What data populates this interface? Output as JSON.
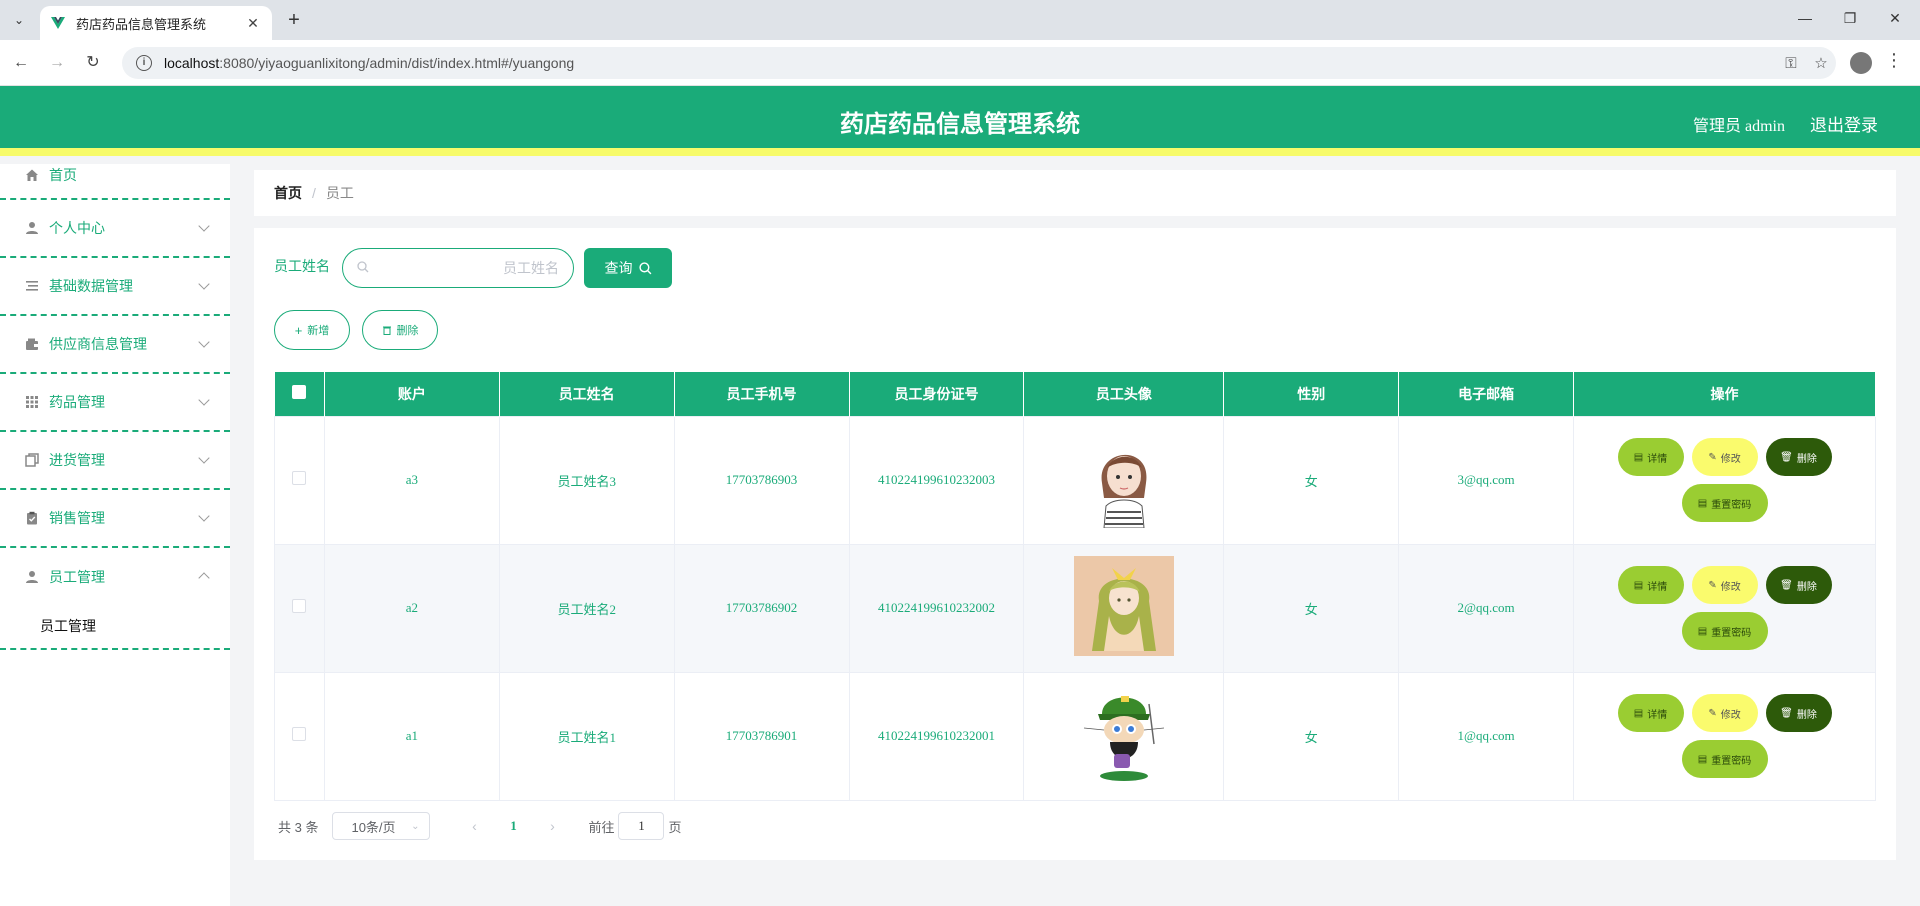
{
  "browser": {
    "tab_title": "药店药品信息管理系统",
    "url_host": "localhost",
    "url_rest": ":8080/yiyaoguanlixitong/admin/dist/index.html#/yuangong"
  },
  "header": {
    "title": "药店药品信息管理系统",
    "admin_label": "管理员 admin",
    "logout_label": "退出登录"
  },
  "sidebar": {
    "items": [
      {
        "label": "首页",
        "icon": "home-icon"
      },
      {
        "label": "个人中心",
        "icon": "user-icon"
      },
      {
        "label": "基础数据管理",
        "icon": "list-icon"
      },
      {
        "label": "供应商信息管理",
        "icon": "wallet-icon"
      },
      {
        "label": "药品管理",
        "icon": "grid-icon"
      },
      {
        "label": "进货管理",
        "icon": "copy-icon"
      },
      {
        "label": "销售管理",
        "icon": "clipboard-icon"
      },
      {
        "label": "员工管理",
        "icon": "user-icon"
      }
    ],
    "submenu_label": "员工管理"
  },
  "breadcrumb": {
    "home": "首页",
    "separator": "/",
    "current": "员工"
  },
  "search": {
    "label": "员工姓名",
    "placeholder": "员工姓名",
    "query_label": "查询"
  },
  "actions": {
    "add_label": "新增",
    "delete_label": "删除"
  },
  "table": {
    "headers": [
      "账户",
      "员工姓名",
      "员工手机号",
      "员工身份证号",
      "员工头像",
      "性别",
      "电子邮箱",
      "操作"
    ],
    "rows": [
      {
        "account": "a3",
        "name": "员工姓名3",
        "phone": "17703786903",
        "idcard": "410224199610232003",
        "avatar": "girl-sketch-avatar",
        "gender": "女",
        "email": "3@qq.com"
      },
      {
        "account": "a2",
        "name": "员工姓名2",
        "phone": "17703786902",
        "idcard": "410224199610232002",
        "avatar": "green-hair-girl-avatar",
        "gender": "女",
        "email": "2@qq.com"
      },
      {
        "account": "a1",
        "name": "员工姓名1",
        "phone": "17703786901",
        "idcard": "410224199610232001",
        "avatar": "octocat-avatar",
        "gender": "女",
        "email": "1@qq.com"
      }
    ],
    "ops": {
      "detail": "详情",
      "edit": "修改",
      "remove": "删除",
      "reset": "重置密码"
    }
  },
  "pager": {
    "total": "共 3 条",
    "page_size": "10条/页",
    "current_page": "1",
    "goto_prefix": "前往",
    "goto_value": "1",
    "goto_suffix": "页"
  },
  "colors": {
    "primary": "#1aab79",
    "accent_yellow": "#f7fb6a",
    "detail_green": "#9acd32",
    "delete_dark": "#2d5a0a"
  }
}
